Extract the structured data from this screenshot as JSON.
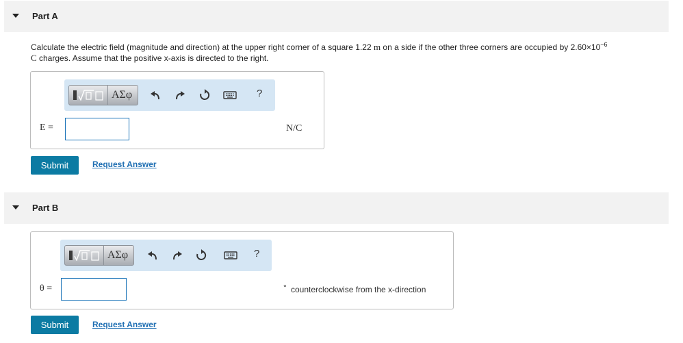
{
  "partA": {
    "title": "Part A",
    "question": {
      "pre": "Calculate the electric field (magnitude and direction) at the upper right corner of a square 1.22 ",
      "side_unit": "m",
      "mid": " on a side if the other three corners are occupied by 2.60×10",
      "exponent": "−6",
      "charge_unit": "C",
      "post": " charges. Assume that the positive x-axis is directed to the right."
    },
    "toolbar": {
      "greek_label": "ΑΣφ",
      "help_label": "?"
    },
    "variable_label": "E =",
    "input_value": "",
    "unit": "N/C",
    "submit_label": "Submit",
    "request_label": "Request Answer"
  },
  "partB": {
    "title": "Part B",
    "toolbar": {
      "greek_label": "ΑΣφ",
      "help_label": "?"
    },
    "variable_label": "θ =",
    "input_value": "",
    "degree_symbol": "°",
    "unit_text": "counterclockwise from the x-direction",
    "submit_label": "Submit",
    "request_label": "Request Answer"
  },
  "icons": [
    "collapse-caret-icon",
    "template-icon",
    "greek-symbols-icon",
    "undo-icon",
    "redo-icon",
    "reset-icon",
    "keyboard-icon",
    "help-icon"
  ],
  "colors": {
    "accent": "#0c7ba3",
    "link": "#1f6fb3",
    "toolbar_bg": "#d5e6f4",
    "header_bg": "#f2f2f2",
    "input_border": "#1a73b8"
  }
}
